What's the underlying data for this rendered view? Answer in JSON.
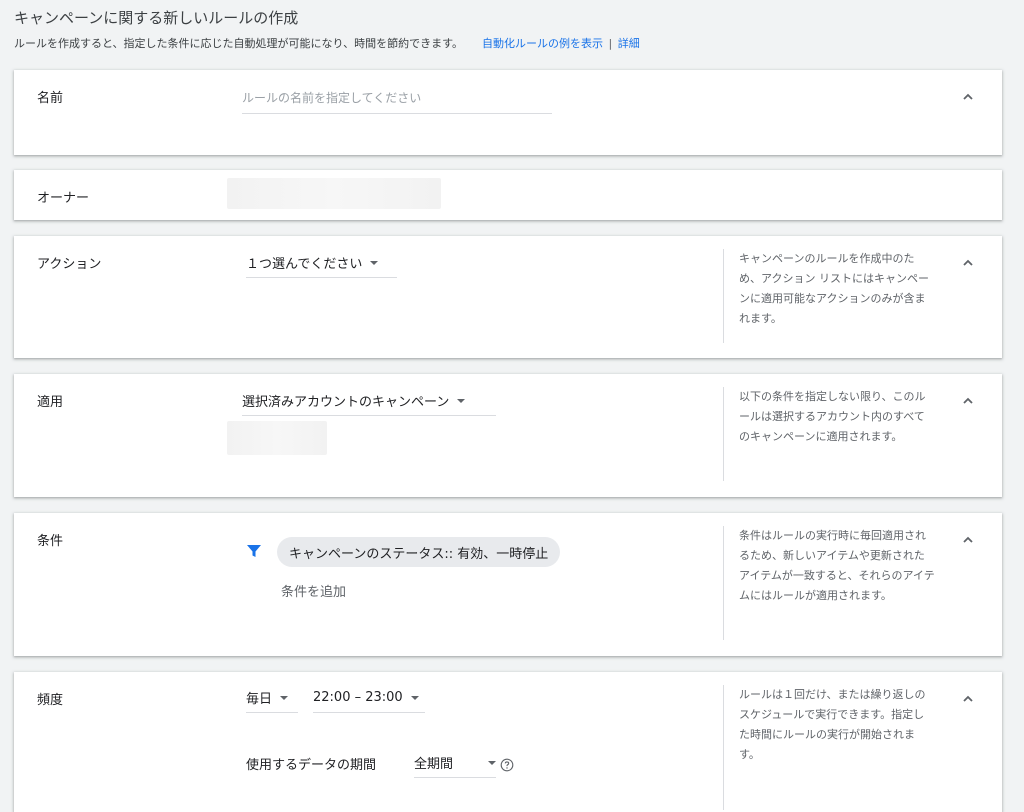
{
  "header": {
    "title": "キャンペーンに関する新しいルールの作成",
    "subtitle": "ルールを作成すると、指定した条件に応じた自動処理が可能になり、時間を節約できます。",
    "examples_link": "自動化ルールの例を表示",
    "separator": "|",
    "details_link": "詳細"
  },
  "name_section": {
    "label": "名前",
    "input_value": "",
    "input_placeholder": "ルールの名前を指定してください"
  },
  "owner_section": {
    "label": "オーナー"
  },
  "action_section": {
    "label": "アクション",
    "dropdown_value": "１つ選んでください",
    "help": "キャンペーンのルールを作成中のため、アクション リストにはキャンペーンに適用可能なアクションのみが含まれます。"
  },
  "apply_section": {
    "label": "適用",
    "dropdown_value": "選択済みアカウントのキャンペーン",
    "help": "以下の条件を指定しない限り、このルールは選択するアカウント内のすべてのキャンペーンに適用されます。"
  },
  "condition_section": {
    "label": "条件",
    "chip": "キャンペーンのステータス:: 有効、一時停止",
    "add_condition": "条件を追加",
    "help": "条件はルールの実行時に毎回適用されるため、新しいアイテムや更新されたアイテムが一致すると、それらのアイテムにはルールが適用されます。"
  },
  "frequency_section": {
    "label": "頻度",
    "frequency_value": "毎日",
    "time_value": "22:00 – 23:00",
    "period_label": "使用するデータの期間",
    "period_value": "全期間",
    "help": "ルールは１回だけ、または繰り返しのスケジュールで実行できます。指定した時間にルールの実行が開始されます。"
  },
  "icons": {
    "collapse": "chevron-up-icon",
    "filter": "filter-icon",
    "help": "help-circle-icon"
  },
  "colors": {
    "accent": "#1a73e8",
    "background": "#f1f3f4",
    "chip": "#e8eaed"
  }
}
